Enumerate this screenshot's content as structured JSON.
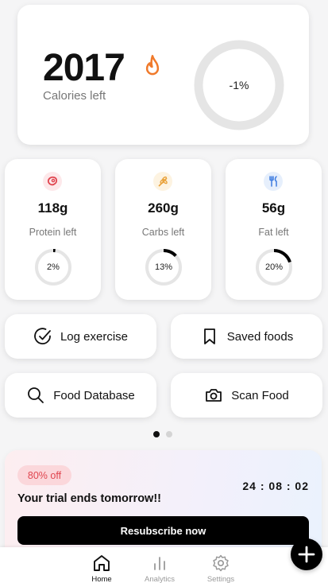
{
  "calories": {
    "value": "2017",
    "label": "Calories left",
    "percent_text": "-1%",
    "progress": 0.0,
    "icon": "flame-icon",
    "accent": "#f07a2b"
  },
  "macros": [
    {
      "key": "protein",
      "value": "118g",
      "label": "Protein left",
      "percent_text": "2%",
      "progress": 0.02,
      "icon": "steak-icon",
      "icon_color": "#e0454f",
      "icon_bg": "#fde8ea"
    },
    {
      "key": "carbs",
      "value": "260g",
      "label": "Carbs left",
      "percent_text": "13%",
      "progress": 0.13,
      "icon": "wheat-icon",
      "icon_color": "#e9a23b",
      "icon_bg": "#fdf3e1"
    },
    {
      "key": "fat",
      "value": "56g",
      "label": "Fat left",
      "percent_text": "20%",
      "progress": 0.2,
      "icon": "fork-knife-icon",
      "icon_color": "#3d7be0",
      "icon_bg": "#e6effc"
    }
  ],
  "actions": {
    "log_exercise": "Log exercise",
    "saved_foods": "Saved foods",
    "food_database": "Food Database",
    "scan_food": "Scan Food"
  },
  "pager": {
    "count": 2,
    "active": 0
  },
  "trial": {
    "badge": "80% off",
    "message": "Your trial ends tomorrow!!",
    "countdown": "24 : 08 : 02",
    "button": "Resubscribe now"
  },
  "nav": {
    "home": "Home",
    "analytics": "Analytics",
    "settings": "Settings",
    "active": "home"
  },
  "colors": {
    "ring_track": "#e5e5e5",
    "ring_fill": "#000000",
    "nav_active": "#111111",
    "nav_inactive": "#9a9a9a"
  }
}
